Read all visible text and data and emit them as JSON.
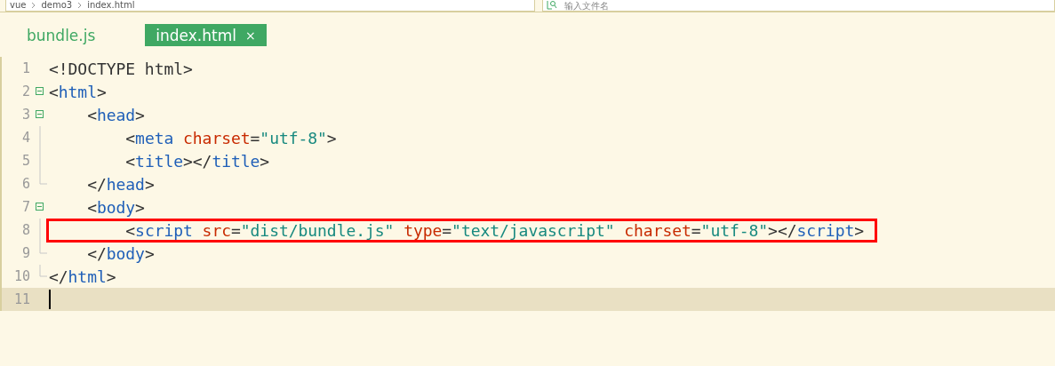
{
  "breadcrumb": [
    "vue",
    "demo3",
    "index.html"
  ],
  "search": {
    "placeholder": "输入文件名"
  },
  "tabs": [
    {
      "label": "bundle.js",
      "selected": false
    },
    {
      "label": "index.html",
      "selected": true,
      "close": "×"
    }
  ],
  "editor": {
    "lines": [
      {
        "number": "1",
        "kind": "plain",
        "current": false,
        "highlighted": false,
        "tokens": [
          {
            "kind": "punct",
            "text": "<!DOCTYPE html>"
          }
        ]
      },
      {
        "number": "2",
        "kind": "fold",
        "current": false,
        "highlighted": false,
        "tokens": [
          {
            "kind": "punct",
            "text": "<"
          },
          {
            "kind": "tag",
            "text": "html"
          },
          {
            "kind": "punct",
            "text": ">"
          }
        ]
      },
      {
        "number": "3",
        "kind": "fold",
        "current": false,
        "highlighted": false,
        "tokens": [
          {
            "kind": "punct",
            "text": "    <"
          },
          {
            "kind": "tag",
            "text": "head"
          },
          {
            "kind": "punct",
            "text": ">"
          }
        ]
      },
      {
        "number": "4",
        "kind": "guide",
        "current": false,
        "highlighted": false,
        "tokens": [
          {
            "kind": "punct",
            "text": "        <"
          },
          {
            "kind": "tag",
            "text": "meta "
          },
          {
            "kind": "attr",
            "text": "charset"
          },
          {
            "kind": "punct",
            "text": "="
          },
          {
            "kind": "value",
            "text": "\"utf-8\""
          },
          {
            "kind": "punct",
            "text": ">"
          }
        ]
      },
      {
        "number": "5",
        "kind": "guide",
        "current": false,
        "highlighted": false,
        "tokens": [
          {
            "kind": "punct",
            "text": "        <"
          },
          {
            "kind": "tag",
            "text": "title"
          },
          {
            "kind": "punct",
            "text": "></"
          },
          {
            "kind": "tag",
            "text": "title"
          },
          {
            "kind": "punct",
            "text": ">"
          }
        ]
      },
      {
        "number": "6",
        "kind": "end",
        "current": false,
        "highlighted": false,
        "tokens": [
          {
            "kind": "punct",
            "text": "    </"
          },
          {
            "kind": "tag",
            "text": "head"
          },
          {
            "kind": "punct",
            "text": ">"
          }
        ]
      },
      {
        "number": "7",
        "kind": "fold",
        "current": false,
        "highlighted": false,
        "tokens": [
          {
            "kind": "punct",
            "text": "    <"
          },
          {
            "kind": "tag",
            "text": "body"
          },
          {
            "kind": "punct",
            "text": ">"
          }
        ]
      },
      {
        "number": "8",
        "kind": "guide",
        "current": false,
        "highlighted": true,
        "tokens": [
          {
            "kind": "punct",
            "text": "        <"
          },
          {
            "kind": "tag",
            "text": "script "
          },
          {
            "kind": "attr",
            "text": "src"
          },
          {
            "kind": "punct",
            "text": "="
          },
          {
            "kind": "value",
            "text": "\"dist/bundle.js\""
          },
          {
            "kind": "attr",
            "text": " type"
          },
          {
            "kind": "punct",
            "text": "="
          },
          {
            "kind": "value",
            "text": "\"text/javascript\""
          },
          {
            "kind": "attr",
            "text": " charset"
          },
          {
            "kind": "punct",
            "text": "="
          },
          {
            "kind": "value",
            "text": "\"utf-8\""
          },
          {
            "kind": "punct",
            "text": "></"
          },
          {
            "kind": "tag",
            "text": "script"
          },
          {
            "kind": "punct",
            "text": ">"
          }
        ]
      },
      {
        "number": "9",
        "kind": "end",
        "current": false,
        "highlighted": false,
        "tokens": [
          {
            "kind": "punct",
            "text": "    </"
          },
          {
            "kind": "tag",
            "text": "body"
          },
          {
            "kind": "punct",
            "text": ">"
          }
        ]
      },
      {
        "number": "10",
        "kind": "end",
        "current": false,
        "highlighted": false,
        "tokens": [
          {
            "kind": "punct",
            "text": "</"
          },
          {
            "kind": "tag",
            "text": "html"
          },
          {
            "kind": "punct",
            "text": ">"
          }
        ]
      },
      {
        "number": "11",
        "kind": "plain",
        "current": true,
        "highlighted": false
      }
    ]
  }
}
